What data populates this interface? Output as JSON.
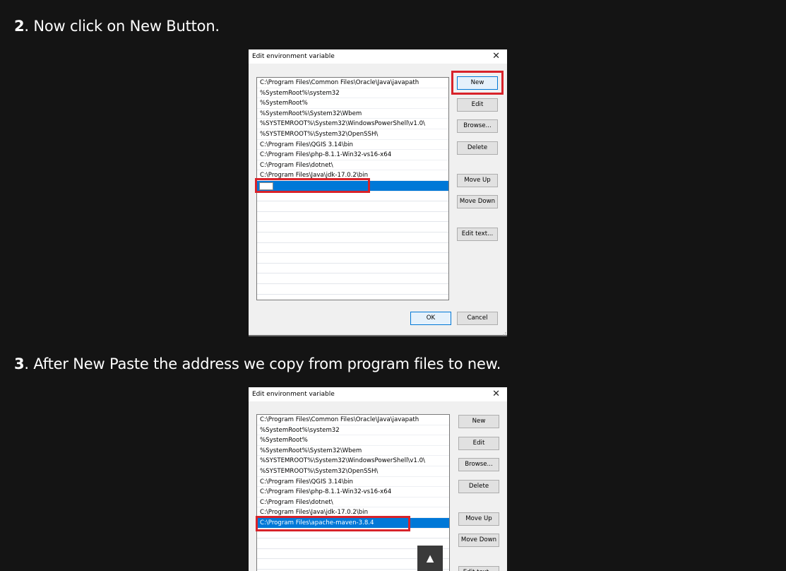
{
  "steps": [
    {
      "number": "2",
      "text": ". Now click on New Button."
    },
    {
      "number": "3",
      "text": ". After New Paste the address we copy from program files to new."
    }
  ],
  "dialog": {
    "title": "Edit environment variable",
    "close_glyph": "✕",
    "buttons": {
      "new": "New",
      "edit": "Edit",
      "browse": "Browse...",
      "delete": "Delete",
      "move_up": "Move Up",
      "move_down": "Move Down",
      "edit_text": "Edit text...",
      "ok": "OK",
      "cancel": "Cancel"
    },
    "paths": [
      "C:\\Program Files\\Common Files\\Oracle\\Java\\javapath",
      "%SystemRoot%\\system32",
      "%SystemRoot%",
      "%SystemRoot%\\System32\\Wbem",
      "%SYSTEMROOT%\\System32\\WindowsPowerShell\\v1.0\\",
      "%SYSTEMROOT%\\System32\\OpenSSH\\",
      "C:\\Program Files\\QGIS 3.14\\bin",
      "C:\\Program Files\\php-8.1.1-Win32-vs16-x64",
      "C:\\Program Files\\dotnet\\",
      "C:\\Program Files\\Java\\jdk-17.0.2\\bin"
    ],
    "new_entry": "C:\\Program Files\\apache-maven-3.8.4"
  },
  "scroll_top_glyph": "▲",
  "colors": {
    "highlight": "#d8232a",
    "selection": "#0078d7"
  }
}
